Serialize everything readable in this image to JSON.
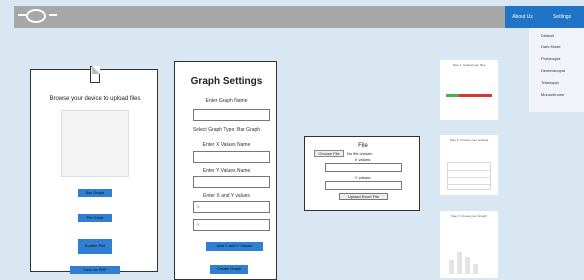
{
  "nav": {
    "about_label": "About Us",
    "settings_label": "Settings"
  },
  "theme_menu": {
    "items": [
      "Default",
      "Dark Mode",
      "Protanopia",
      "Deuteranopia",
      "Tritanopia",
      "Monochrome"
    ]
  },
  "upload_panel": {
    "browse_label": "Browse your device to upload files",
    "buttons": [
      "Bar Graph",
      "Pie Chart",
      "Scatter Plot",
      "Save as PDF"
    ]
  },
  "graph_settings": {
    "title": "Graph Settings",
    "graph_name_label": "Enter Graph Name",
    "graph_type_label": "Select Graph Type: Bar Graph",
    "x_name_label": "Enter X Values Name",
    "y_name_label": "Enter Y Values Name",
    "xy_label": "Enter X and Y values",
    "x_placeholder": "X",
    "y_placeholder": "Y",
    "add_button": "Add X and Y Values",
    "create_button": "Create Graph"
  },
  "file_panel": {
    "title": "File",
    "choose_label": "Choose File",
    "no_file": "No file chosen",
    "x_values_label": "X values:",
    "y_values_label": "Y values:",
    "upload_button": "Upload Excel File"
  },
  "steps": {
    "step1": "Step 1: Upload your files",
    "step2": "Step 2: Choose your settings",
    "step3": "Step 3: Create your Graph!"
  },
  "colors": {
    "accent": "#2f7fd2",
    "background": "#d9e7f3",
    "step1_green": "#48b24f",
    "step1_red": "#d9362d"
  }
}
